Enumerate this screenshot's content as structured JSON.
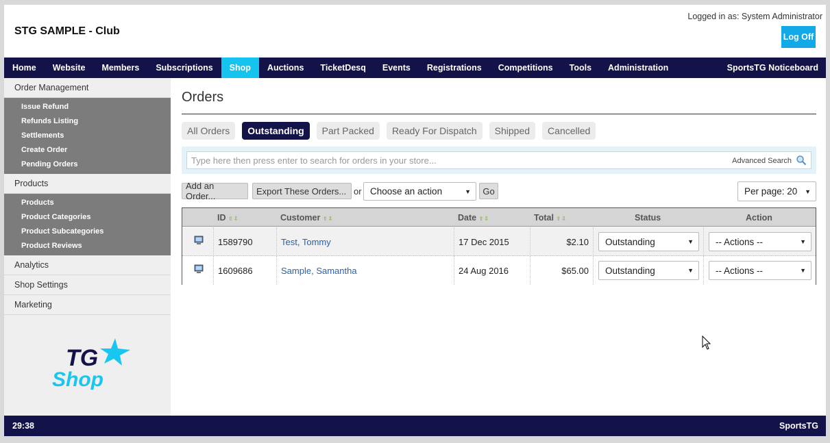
{
  "header": {
    "site_title": "STG SAMPLE - Club",
    "logged_in_as": "Logged in as: System Administrator",
    "logoff_label": "Log Off"
  },
  "nav": {
    "items": [
      "Home",
      "Website",
      "Members",
      "Subscriptions",
      "Shop",
      "Auctions",
      "TicketDesq",
      "Events",
      "Registrations",
      "Competitions",
      "Tools",
      "Administration"
    ],
    "active": "Shop",
    "right_item": "SportsTG Noticeboard"
  },
  "sidebar": {
    "order_management": {
      "label": "Order Management",
      "items": [
        "Issue Refund",
        "Refunds Listing",
        "Settlements",
        "Create Order",
        "Pending Orders"
      ]
    },
    "products": {
      "label": "Products",
      "items": [
        "Products",
        "Product Categories",
        "Product Subcategories",
        "Product Reviews"
      ]
    },
    "others": [
      "Analytics",
      "Shop Settings",
      "Marketing"
    ],
    "logo": {
      "line1": "TG",
      "line2": "Shop"
    }
  },
  "main": {
    "title": "Orders",
    "tabs": [
      "All Orders",
      "Outstanding",
      "Part Packed",
      "Ready For Dispatch",
      "Shipped",
      "Cancelled"
    ],
    "active_tab": "Outstanding",
    "search": {
      "placeholder": "Type here then press enter to search for orders in your store...",
      "advanced_label": "Advanced Search"
    },
    "toolbar": {
      "add_order": "Add an Order...",
      "export": "Export These Orders...",
      "or": "or",
      "action_select": "Choose an action",
      "go": "Go",
      "per_page": "Per page: 20"
    },
    "table": {
      "columns": [
        "ID",
        "Customer",
        "Date",
        "Total",
        "Status",
        "Action"
      ],
      "rows": [
        {
          "id": "1589790",
          "last": "Test",
          "first": "Tommy",
          "date": "17 Dec 2015",
          "total": "$2.10",
          "status": "Outstanding",
          "action": "-- Actions --"
        },
        {
          "id": "1609686",
          "last": "Sample",
          "first": "Samantha",
          "date": "24 Aug 2016",
          "total": "$65.00",
          "status": "Outstanding",
          "action": "-- Actions --"
        }
      ]
    }
  },
  "footer": {
    "left": "29:38",
    "right": "SportsTG"
  },
  "colors": {
    "nav_bg": "#13134a",
    "active_nav": "#14c4ee",
    "logoff": "#12a9e6",
    "link": "#2b5fa6"
  }
}
